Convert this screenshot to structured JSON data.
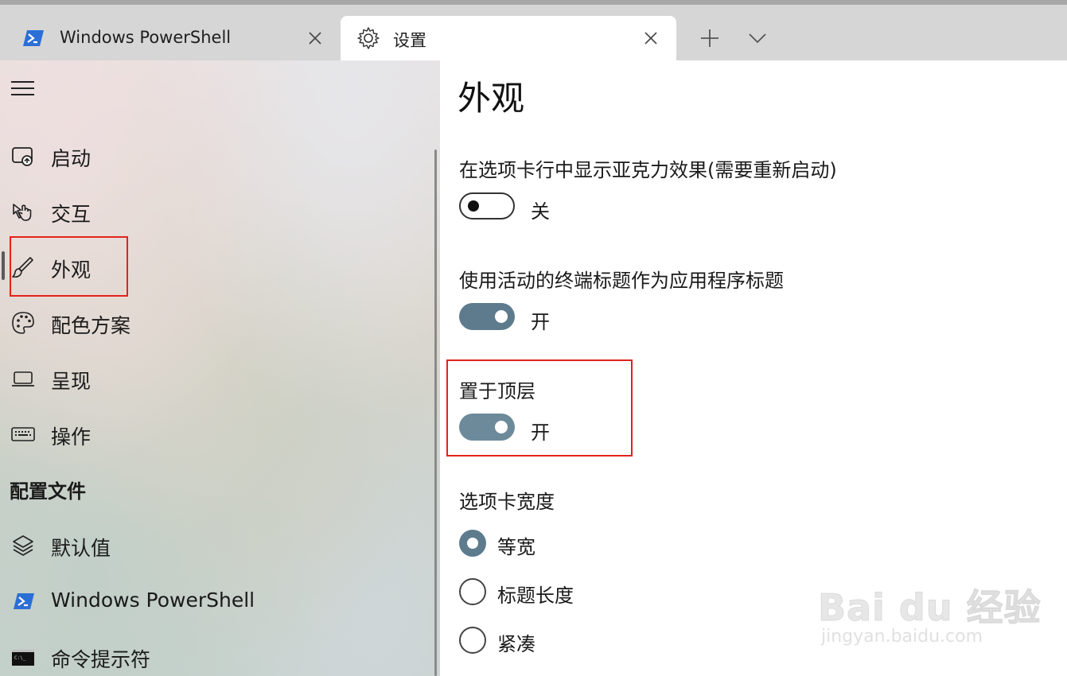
{
  "tabs": [
    {
      "label": "Windows PowerShell",
      "icon": "powershell-icon",
      "active": false
    },
    {
      "label": "设置",
      "icon": "gear-icon",
      "active": true
    }
  ],
  "tab_controls": {
    "new_tab_icon": "plus-icon",
    "dropdown_icon": "chevron-down-icon"
  },
  "sidebar": {
    "menu_icon": "hamburger-icon",
    "items": [
      {
        "label": "启动",
        "icon": "startup-icon"
      },
      {
        "label": "交互",
        "icon": "interaction-icon"
      },
      {
        "label": "外观",
        "icon": "brush-icon",
        "selected": true
      },
      {
        "label": "配色方案",
        "icon": "palette-icon"
      },
      {
        "label": "呈现",
        "icon": "laptop-icon"
      },
      {
        "label": "操作",
        "icon": "keyboard-icon"
      }
    ],
    "profiles_header": "配置文件",
    "profiles": [
      {
        "label": "默认值",
        "icon": "layers-icon"
      },
      {
        "label": "Windows PowerShell",
        "icon": "powershell-icon"
      },
      {
        "label": "命令提示符",
        "icon": "cmd-icon"
      }
    ]
  },
  "main": {
    "title": "外观",
    "settings": [
      {
        "label": "在选项卡行中显示亚克力效果(需要重新启动)",
        "state": "关",
        "on": false
      },
      {
        "label": "使用活动的终端标题作为应用程序标题",
        "state": "开",
        "on": true
      },
      {
        "label": "置于顶层",
        "state": "开",
        "on": true
      }
    ],
    "tab_width": {
      "label": "选项卡宽度",
      "options": [
        "等宽",
        "标题长度",
        "紧凑"
      ],
      "selected": "等宽"
    }
  },
  "watermark": {
    "main": "Bai du 经验",
    "sub": "jingyan.baidu.com"
  },
  "colors": {
    "accent": "#5d7b8d",
    "highlight_box": "#e2231a",
    "tabstrip": "#d6d6d6"
  }
}
